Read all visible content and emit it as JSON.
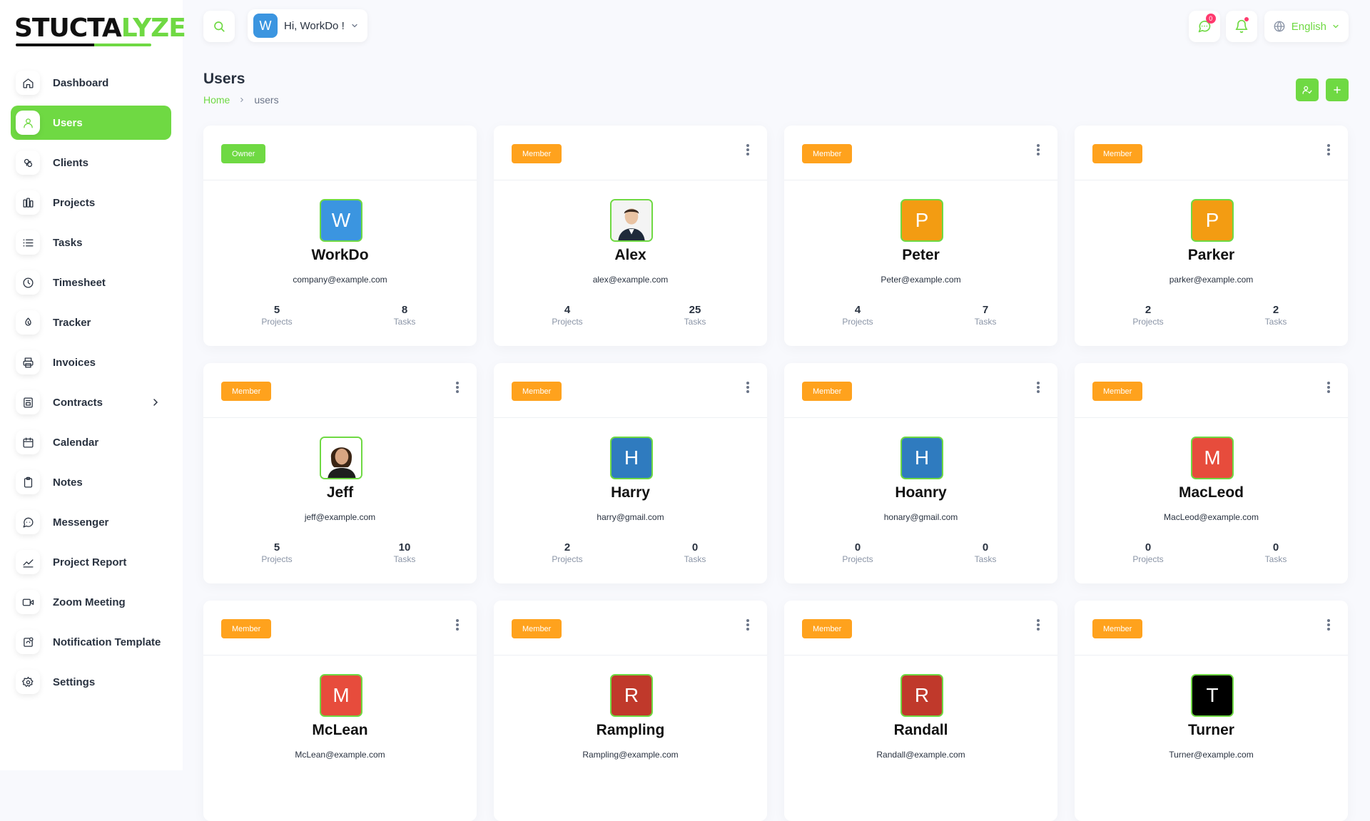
{
  "app": {
    "logo_dark": "STUCTA",
    "logo_green": "LYZE"
  },
  "sidebar": {
    "items": [
      {
        "label": "Dashboard",
        "icon": "home-icon",
        "active": false
      },
      {
        "label": "Users",
        "icon": "user-icon",
        "active": true
      },
      {
        "label": "Clients",
        "icon": "clients-icon",
        "active": false
      },
      {
        "label": "Projects",
        "icon": "projects-icon",
        "active": false
      },
      {
        "label": "Tasks",
        "icon": "list-icon",
        "active": false
      },
      {
        "label": "Timesheet",
        "icon": "clock-icon",
        "active": false
      },
      {
        "label": "Tracker",
        "icon": "tracker-icon",
        "active": false
      },
      {
        "label": "Invoices",
        "icon": "printer-icon",
        "active": false
      },
      {
        "label": "Contracts",
        "icon": "contract-icon",
        "active": false
      },
      {
        "label": "Calendar",
        "icon": "calendar-icon",
        "active": false
      },
      {
        "label": "Notes",
        "icon": "clipboard-icon",
        "active": false
      },
      {
        "label": "Messenger",
        "icon": "chat-icon",
        "active": false
      },
      {
        "label": "Project Report",
        "icon": "chart-icon",
        "active": false
      },
      {
        "label": "Zoom Meeting",
        "icon": "video-icon",
        "active": false
      },
      {
        "label": "Notification Template",
        "icon": "notification-icon",
        "active": false
      },
      {
        "label": "Settings",
        "icon": "gear-icon",
        "active": false
      }
    ]
  },
  "topbar": {
    "user_initial": "W",
    "greeting": "Hi, WorkDo !",
    "messages_badge": "0",
    "language": "English"
  },
  "page": {
    "title": "Users",
    "breadcrumb_home": "Home",
    "breadcrumb_current": "users"
  },
  "users": [
    {
      "name": "WorkDo",
      "email": "company@example.com",
      "role": "Owner",
      "projects": "5",
      "tasks": "8",
      "initial": "W",
      "color": "#3b95e0",
      "photo": false
    },
    {
      "name": "Alex",
      "email": "alex@example.com",
      "role": "Member",
      "projects": "4",
      "tasks": "25",
      "initial": "",
      "color": "#ffffff",
      "photo": true
    },
    {
      "name": "Peter",
      "email": "Peter@example.com",
      "role": "Member",
      "projects": "4",
      "tasks": "7",
      "initial": "P",
      "color": "#f39c12",
      "photo": false
    },
    {
      "name": "Parker",
      "email": "parker@example.com",
      "role": "Member",
      "projects": "2",
      "tasks": "2",
      "initial": "P",
      "color": "#f39c12",
      "photo": false
    },
    {
      "name": "Jeff",
      "email": "jeff@example.com",
      "role": "Member",
      "projects": "5",
      "tasks": "10",
      "initial": "",
      "color": "#ffffff",
      "photo": true
    },
    {
      "name": "Harry",
      "email": "harry@gmail.com",
      "role": "Member",
      "projects": "2",
      "tasks": "0",
      "initial": "H",
      "color": "#2f7bbf",
      "photo": false
    },
    {
      "name": "Hoanry",
      "email": "honary@gmail.com",
      "role": "Member",
      "projects": "0",
      "tasks": "0",
      "initial": "H",
      "color": "#2f7bbf",
      "photo": false
    },
    {
      "name": "MacLeod",
      "email": "MacLeod@example.com",
      "role": "Member",
      "projects": "0",
      "tasks": "0",
      "initial": "M",
      "color": "#e74c3c",
      "photo": false
    },
    {
      "name": "McLean",
      "email": "McLean@example.com",
      "role": "Member",
      "projects": "",
      "tasks": "",
      "initial": "M",
      "color": "#e74c3c",
      "photo": false
    },
    {
      "name": "Rampling",
      "email": "Rampling@example.com",
      "role": "Member",
      "projects": "",
      "tasks": "",
      "initial": "R",
      "color": "#c0392b",
      "photo": false
    },
    {
      "name": "Randall",
      "email": "Randall@example.com",
      "role": "Member",
      "projects": "",
      "tasks": "",
      "initial": "R",
      "color": "#c0392b",
      "photo": false
    },
    {
      "name": "Turner",
      "email": "Turner@example.com",
      "role": "Member",
      "projects": "",
      "tasks": "",
      "initial": "T",
      "color": "#000000",
      "photo": false
    }
  ],
  "labels": {
    "projects": "Projects",
    "tasks": "Tasks"
  },
  "colors": {
    "accent": "#6fd943",
    "member_badge": "#ffa21d"
  }
}
